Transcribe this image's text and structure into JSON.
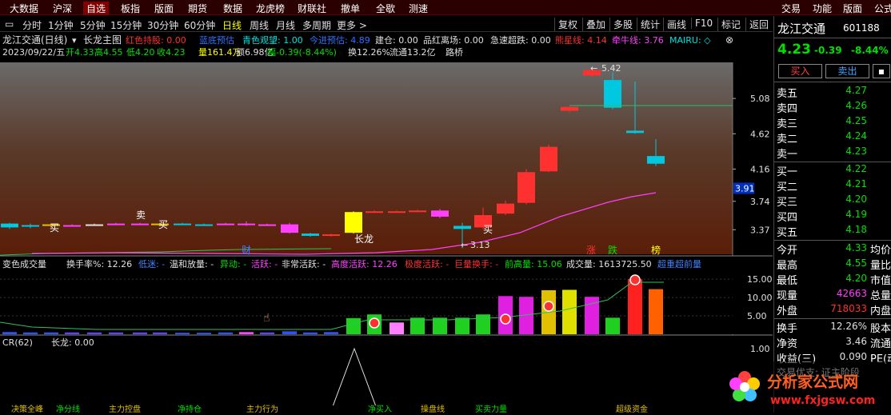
{
  "top_menu": [
    "大数据",
    "沪深",
    "自选",
    "板指",
    "版面",
    "期货",
    "数据",
    "龙虎榜",
    "财联社",
    "撤单",
    "全歇",
    "测速"
  ],
  "top_menu_right": [
    "交易",
    "功能",
    "版面",
    "公式"
  ],
  "periods": [
    "分时",
    "1分钟",
    "5分钟",
    "15分钟",
    "30分钟",
    "60分钟",
    "日线",
    "周线",
    "月线",
    "多周期",
    "更多 >"
  ],
  "active_period": "日线",
  "right_tools": [
    "复权",
    "叠加",
    "多股",
    "统计",
    "画线",
    "F10",
    "标记",
    "返回"
  ],
  "main_chart": {
    "header_title": "龙江交通(日线)",
    "indicator_name": "长龙主图",
    "indicators": [
      {
        "text": "红色持股: 0.00",
        "color": "#ff3030"
      },
      {
        "text": "蓝底预估",
        "color": "#3070ff"
      },
      {
        "text": "青色观望: 1.00",
        "color": "#00e0e0"
      },
      {
        "text": "今进预估: 4.89",
        "color": "#3070ff"
      },
      {
        "text": "建仓: 0.00",
        "color": "#e0e0e0"
      },
      {
        "text": "品红离场: 0.00",
        "color": "#e0e0e0"
      },
      {
        "text": "急速超跌: 0.00",
        "color": "#e0e0e0"
      },
      {
        "text": "熊星线: 4.14",
        "color": "#ff3030"
      },
      {
        "text": "牵牛线: 3.76",
        "color": "#ff40ff"
      },
      {
        "text": "MAIRU: ◇",
        "color": "#00e0e0"
      }
    ],
    "info_line": [
      {
        "text": "2023/09/22/五",
        "color": "#e0e0e0"
      },
      {
        "text": "开4.33",
        "color": "#00e000"
      },
      {
        "text": "高4.55",
        "color": "#00e000"
      },
      {
        "text": "低4.20",
        "color": "#00e000"
      },
      {
        "text": "收4.23",
        "color": "#00e000"
      },
      {
        "text": "量161.4万",
        "color": "#ffff00"
      },
      {
        "text": "额6.98亿",
        "color": "#e0e0e0"
      },
      {
        "text": "幅-0.39(-8.44%)",
        "color": "#00e000"
      },
      {
        "text": "换12.26%",
        "color": "#e0e0e0"
      },
      {
        "text": "流通13.2亿",
        "color": "#e0e0e0"
      },
      {
        "text": "路桥",
        "color": "#e0e0e0"
      }
    ],
    "y_ticks": [
      "5.08",
      "4.62",
      "4.16",
      "3.74",
      "3.37"
    ],
    "current_price_tag": "3.91",
    "annotations": {
      "high": "5.42",
      "low": "3.13"
    },
    "signals": {
      "buy": "买",
      "sell": "卖",
      "long": "长龙"
    },
    "markers": [
      {
        "text": "财",
        "color": "#4080ff"
      },
      {
        "text": "涨",
        "color": "#ff3030"
      },
      {
        "text": "跌",
        "color": "#00e000"
      },
      {
        "text": "榜",
        "color": "#ffff00"
      }
    ]
  },
  "volume_panel": {
    "header": [
      {
        "text": "变色成交量",
        "color": "#e0e0e0"
      },
      {
        "text": "换手率%: 12.26",
        "color": "#e0e0e0"
      },
      {
        "text": "低迷: -",
        "color": "#4080ff"
      },
      {
        "text": "温和放量: -",
        "color": "#e0e0e0"
      },
      {
        "text": "异动: -",
        "color": "#00e000"
      },
      {
        "text": "活跃: -",
        "color": "#ff40ff"
      },
      {
        "text": "非常活跃: -",
        "color": "#e0e0e0"
      },
      {
        "text": "高度活跃: 12.26",
        "color": "#ff40ff"
      },
      {
        "text": "极度活跃: -",
        "color": "#ff3030"
      },
      {
        "text": "巨量换手: -",
        "color": "#ff3030"
      },
      {
        "text": "前高量: 15.06",
        "color": "#00e000"
      },
      {
        "text": "成交量: 1613725.50",
        "color": "#e0e0e0"
      },
      {
        "text": "超重超前量",
        "color": "#4080ff"
      }
    ],
    "y_ticks": [
      "15.00",
      "10.00",
      "5.00"
    ]
  },
  "cr_panel": {
    "header_name": "CR(62)",
    "header_value": "长龙: 0.00",
    "y_ticks": [
      "1.00"
    ]
  },
  "bottom_strip": [
    "决策全峰",
    "净分线",
    "主力控盘",
    "净持仓",
    "主力行为",
    "净买入",
    "操盘线",
    "买卖力量",
    "超级资金"
  ],
  "right_panel": {
    "name": "龙江交通",
    "code": "601188",
    "price": "4.23",
    "change": "-0.39",
    "change_pct": "-8.44%",
    "buy_btn": "买入",
    "sell_btn": "卖出",
    "sells": [
      {
        "label": "卖五",
        "price": "4.27"
      },
      {
        "label": "卖四",
        "price": "4.26"
      },
      {
        "label": "卖三",
        "price": "4.25"
      },
      {
        "label": "卖二",
        "price": "4.24"
      },
      {
        "label": "卖一",
        "price": "4.23"
      }
    ],
    "buys": [
      {
        "label": "买一",
        "price": "4.22"
      },
      {
        "label": "买二",
        "price": "4.21"
      },
      {
        "label": "买三",
        "price": "4.20"
      },
      {
        "label": "买四",
        "price": "4.19"
      },
      {
        "label": "买五",
        "price": "4.18"
      }
    ],
    "stats": [
      {
        "label": "今开",
        "value": "4.33",
        "color": "#00e000",
        "label2": "均价"
      },
      {
        "label": "最高",
        "value": "4.55",
        "color": "#00e000",
        "label2": "量比"
      },
      {
        "label": "最低",
        "value": "4.20",
        "color": "#00e000",
        "label2": "市值"
      },
      {
        "label": "现量",
        "value": "42663",
        "color": "#ff40ff",
        "label2": "总量"
      },
      {
        "label": "外盘",
        "value": "718033",
        "color": "#ff3030",
        "label2": "内盘"
      }
    ],
    "stats2": [
      {
        "label": "换手",
        "value": "12.26%",
        "color": "#e0e0e0",
        "label2": "股本"
      },
      {
        "label": "净资",
        "value": "3.46",
        "color": "#e0e0e0",
        "label2": "流通"
      },
      {
        "label": "收益(三)",
        "value": "0.090",
        "color": "#e0e0e0",
        "label2": "PE(动"
      }
    ],
    "footer": "交易优支: 证主阶段"
  },
  "watermark": {
    "title": "分析家公式网",
    "url": "www.fxjgsw.com"
  }
}
